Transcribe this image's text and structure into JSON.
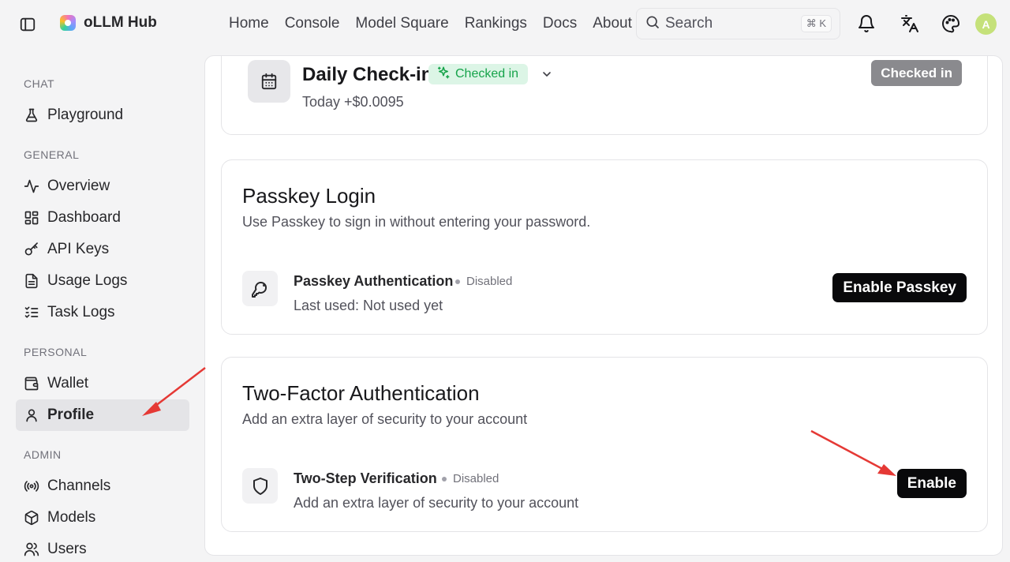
{
  "brand": {
    "name": "oLLM Hub"
  },
  "nav": [
    "Home",
    "Console",
    "Model Square",
    "Rankings",
    "Docs",
    "About"
  ],
  "search": {
    "placeholder": "Search",
    "shortcut": "⌘ K"
  },
  "user": {
    "avatar_letter": "A",
    "avatar_color": "#c5e17a"
  },
  "sidebar": {
    "groups": [
      {
        "label": "CHAT",
        "items": [
          {
            "label": "Playground",
            "icon": "flask-icon"
          }
        ]
      },
      {
        "label": "GENERAL",
        "items": [
          {
            "label": "Overview",
            "icon": "activity-icon"
          },
          {
            "label": "Dashboard",
            "icon": "dashboard-icon"
          },
          {
            "label": "API Keys",
            "icon": "key-icon"
          },
          {
            "label": "Usage Logs",
            "icon": "document-icon"
          },
          {
            "label": "Task Logs",
            "icon": "list-check-icon"
          }
        ]
      },
      {
        "label": "PERSONAL",
        "items": [
          {
            "label": "Wallet",
            "icon": "wallet-icon"
          },
          {
            "label": "Profile",
            "icon": "user-icon",
            "active": true
          }
        ]
      },
      {
        "label": "ADMIN",
        "items": [
          {
            "label": "Channels",
            "icon": "broadcast-icon"
          },
          {
            "label": "Models",
            "icon": "cube-icon"
          },
          {
            "label": "Users",
            "icon": "users-icon"
          }
        ]
      }
    ]
  },
  "checkin": {
    "title": "Daily Check-in",
    "badge": "Checked in",
    "subtitle": "Today +$0.0095",
    "button": "Checked in",
    "badge_color": "#16a34a"
  },
  "passkey": {
    "title": "Passkey Login",
    "description": "Use Passkey to sign in without entering your password.",
    "feature_name": "Passkey Authentication",
    "status": "Disabled",
    "last_used": "Last used: Not used yet",
    "button": "Enable Passkey"
  },
  "twofa": {
    "title": "Two-Factor Authentication",
    "description": "Add an extra layer of security to your account",
    "feature_name": "Two-Step Verification",
    "status": "Disabled",
    "subtitle": "Add an extra layer of security to your account",
    "button": "Enable"
  },
  "annotation_color": "#e53935"
}
